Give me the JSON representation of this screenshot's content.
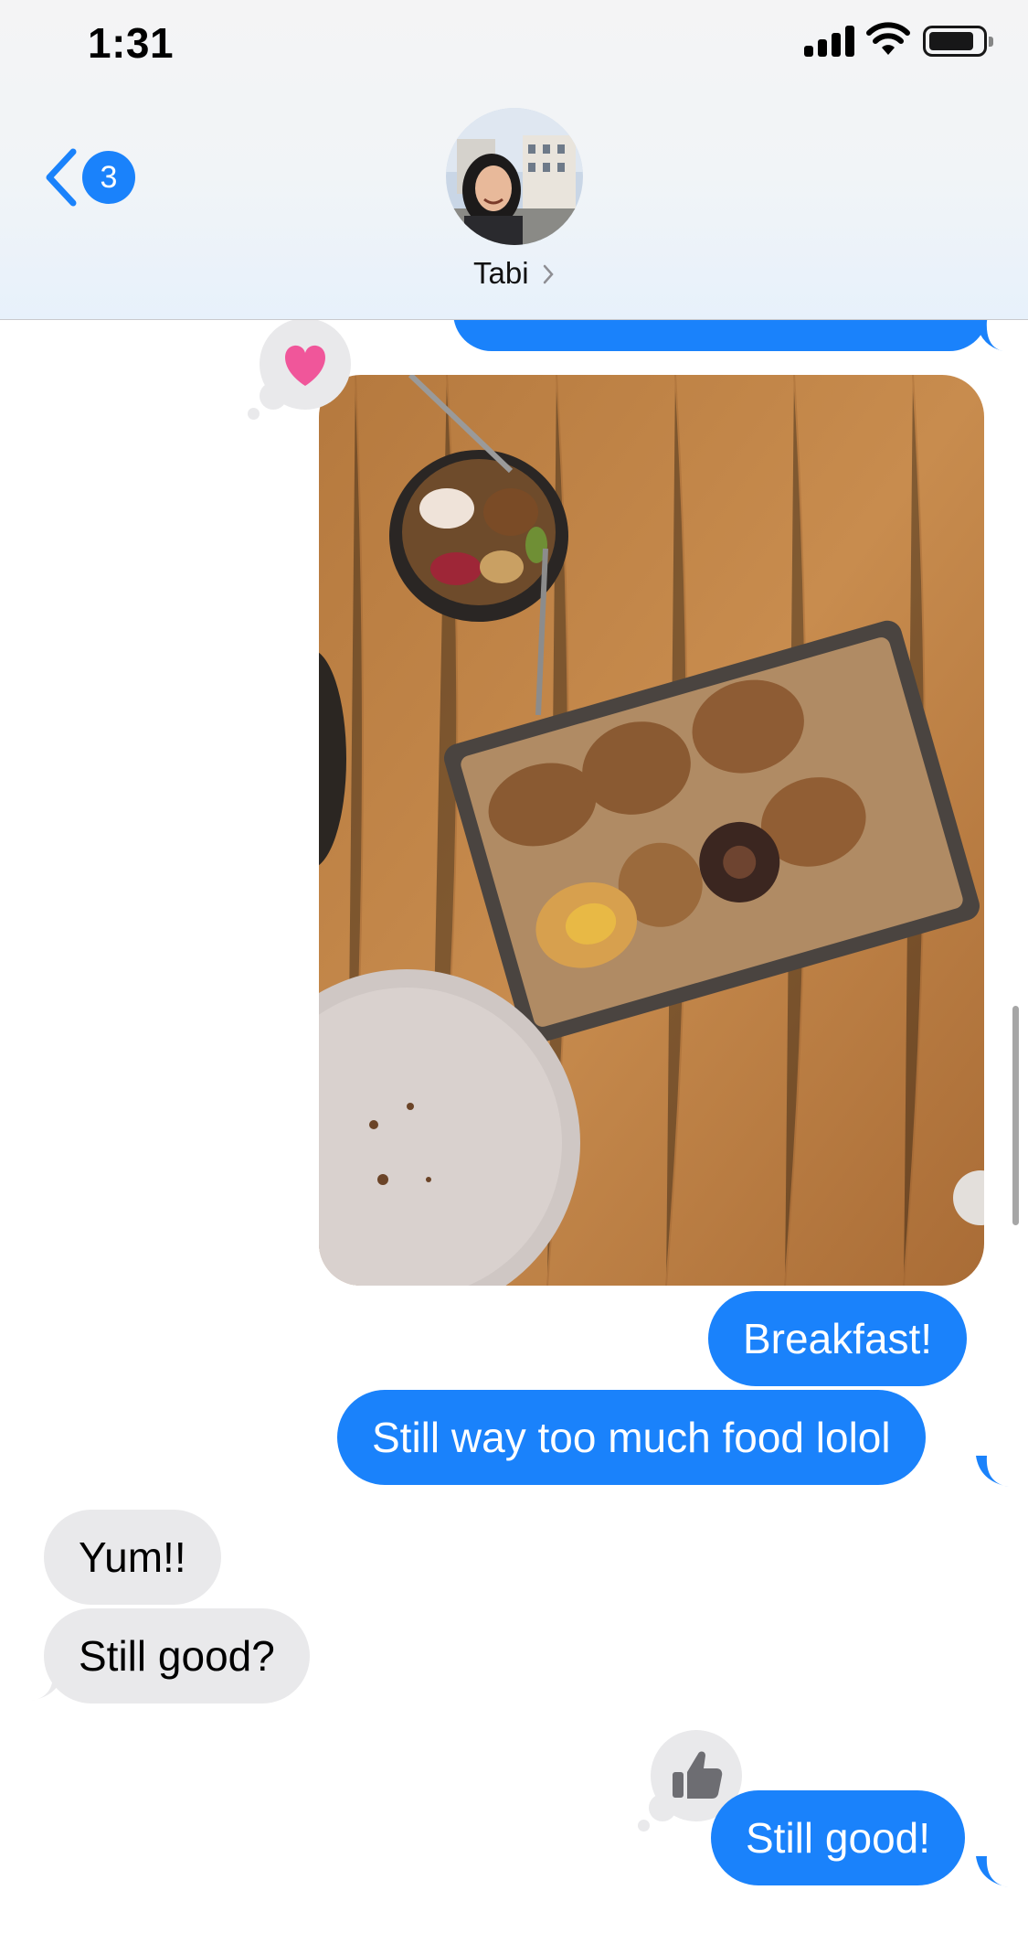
{
  "status_bar": {
    "time": "1:31",
    "icons": [
      "cellular-signal-icon",
      "wifi-icon",
      "battery-icon"
    ]
  },
  "header": {
    "back_badge_count": "3",
    "contact_name": "Tabi",
    "icons": [
      "chevron-left-icon",
      "chevron-right-icon"
    ]
  },
  "messages": {
    "photo_reaction": "heart",
    "sent_1": "Breakfast!",
    "sent_2": "Still way too much food lolol",
    "received_1": "Yum!!",
    "received_2": "Still good?",
    "sent_3": "Still good!",
    "sent_3_reaction": "thumbs-up"
  },
  "colors": {
    "sent_bubble": "#1a82fb",
    "received_bubble": "#e9e9eb",
    "heart": "#f0569a",
    "badge": "#1a82fb"
  }
}
